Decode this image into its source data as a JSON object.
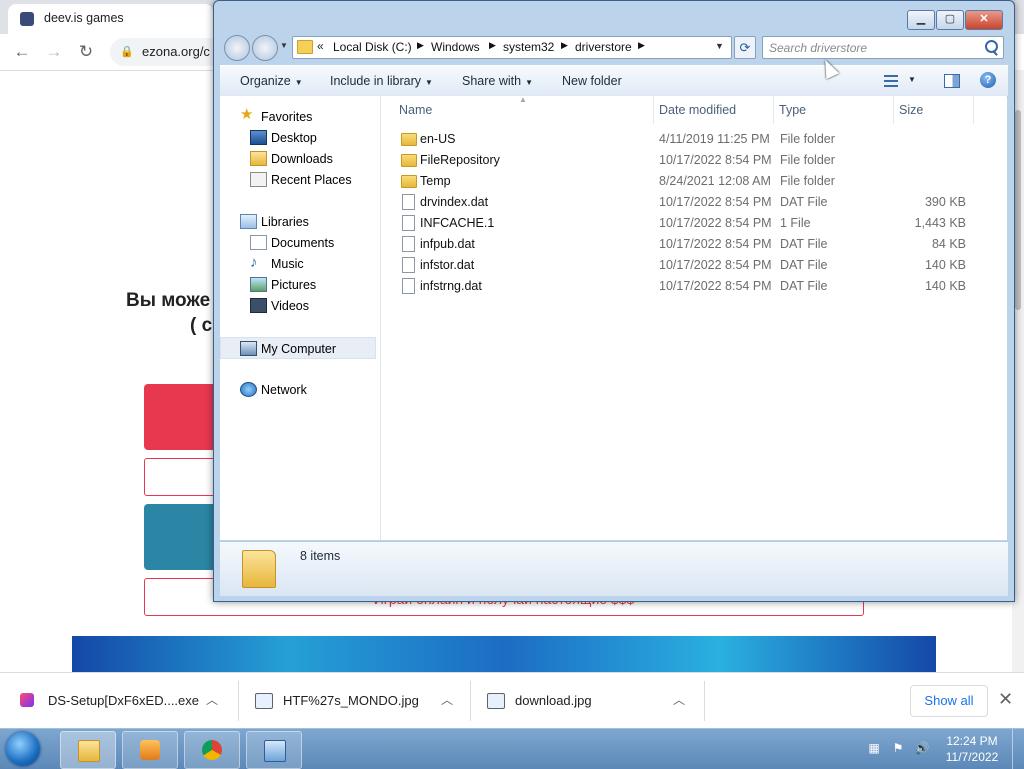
{
  "browser": {
    "tab_title": "deev.is games",
    "url": "ezona.org/c"
  },
  "page": {
    "heading": "Вы може",
    "subheading": "( с",
    "promo_text": "Играй онлайн и получай настоящие $$$"
  },
  "downloads": {
    "items": [
      {
        "name": "DS-Setup[DxF6xED....exe"
      },
      {
        "name": "HTF%27s_MONDO.jpg"
      },
      {
        "name": "download.jpg"
      }
    ],
    "show_all": "Show all"
  },
  "taskbar": {
    "time": "12:24 PM",
    "date": "11/7/2022"
  },
  "explorer": {
    "breadcrumb": {
      "overflow": "«",
      "items": [
        "Local Disk (C:)",
        "Windows",
        "system32",
        "driverstore"
      ]
    },
    "search_placeholder": "Search driverstore",
    "commands": {
      "organize": "Organize",
      "include_in_library": "Include in library",
      "share_with": "Share with",
      "new_folder": "New folder"
    },
    "nav": {
      "favorites": "Favorites",
      "desktop": "Desktop",
      "downloads": "Downloads",
      "recent_places": "Recent Places",
      "libraries": "Libraries",
      "documents": "Documents",
      "music": "Music",
      "pictures": "Pictures",
      "videos": "Videos",
      "my_computer": "My Computer",
      "network": "Network"
    },
    "columns": {
      "name": "Name",
      "date_modified": "Date modified",
      "type": "Type",
      "size": "Size"
    },
    "files": [
      {
        "name": "en-US",
        "date": "4/11/2019 11:25 PM",
        "type": "File folder",
        "size": "",
        "kind": "folder"
      },
      {
        "name": "FileRepository",
        "date": "10/17/2022 8:54 PM",
        "type": "File folder",
        "size": "",
        "kind": "folder"
      },
      {
        "name": "Temp",
        "date": "8/24/2021 12:08 AM",
        "type": "File folder",
        "size": "",
        "kind": "folder"
      },
      {
        "name": "drvindex.dat",
        "date": "10/17/2022 8:54 PM",
        "type": "DAT File",
        "size": "390 KB",
        "kind": "file"
      },
      {
        "name": "INFCACHE.1",
        "date": "10/17/2022 8:54 PM",
        "type": "1 File",
        "size": "1,443 KB",
        "kind": "file"
      },
      {
        "name": "infpub.dat",
        "date": "10/17/2022 8:54 PM",
        "type": "DAT File",
        "size": "84 KB",
        "kind": "file"
      },
      {
        "name": "infstor.dat",
        "date": "10/17/2022 8:54 PM",
        "type": "DAT File",
        "size": "140 KB",
        "kind": "file"
      },
      {
        "name": "infstrng.dat",
        "date": "10/17/2022 8:54 PM",
        "type": "DAT File",
        "size": "140 KB",
        "kind": "file"
      }
    ],
    "item_count": "8 items"
  },
  "colors": {
    "accent_red": "#e8384f",
    "accent_teal": "#2a86a4",
    "link_blue": "#1a73e8"
  }
}
